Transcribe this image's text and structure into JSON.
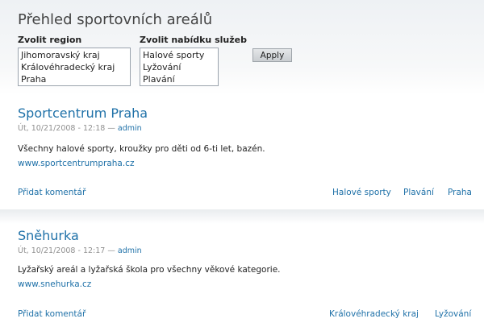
{
  "page_title": "Přehled sportovních areálů",
  "filters": {
    "region_label": "Zvolit region",
    "region_options": [
      "Jihomoravský kraj",
      "Královéhradecký kraj",
      "Praha"
    ],
    "service_label": "Zvolit nabídku služeb",
    "service_options": [
      "Halové sporty",
      "Lyžování",
      "Plavání"
    ],
    "apply_label": "Apply"
  },
  "nodes": [
    {
      "title": "Sportcentrum Praha",
      "date": "Út, 10/21/2008 - 12:18",
      "separator": " — ",
      "author": "admin",
      "body": "Všechny halové sporty, kroužky pro děti od 6-ti let, bazén.",
      "url": "www.sportcentrumpraha.cz",
      "comment_link": "Přidat komentář",
      "tags": [
        "Halové sporty",
        "Plavání",
        "Praha"
      ]
    },
    {
      "title": "Sněhurka",
      "date": "Út, 10/21/2008 - 12:17",
      "separator": " — ",
      "author": "admin",
      "body": "Lyžařský areál a lyžařská škola pro všechny věkové kategorie.",
      "url": "www.snehurka.cz",
      "comment_link": "Přidat komentář",
      "tags": [
        "Královéhradecký kraj",
        "Lyžování"
      ]
    }
  ]
}
